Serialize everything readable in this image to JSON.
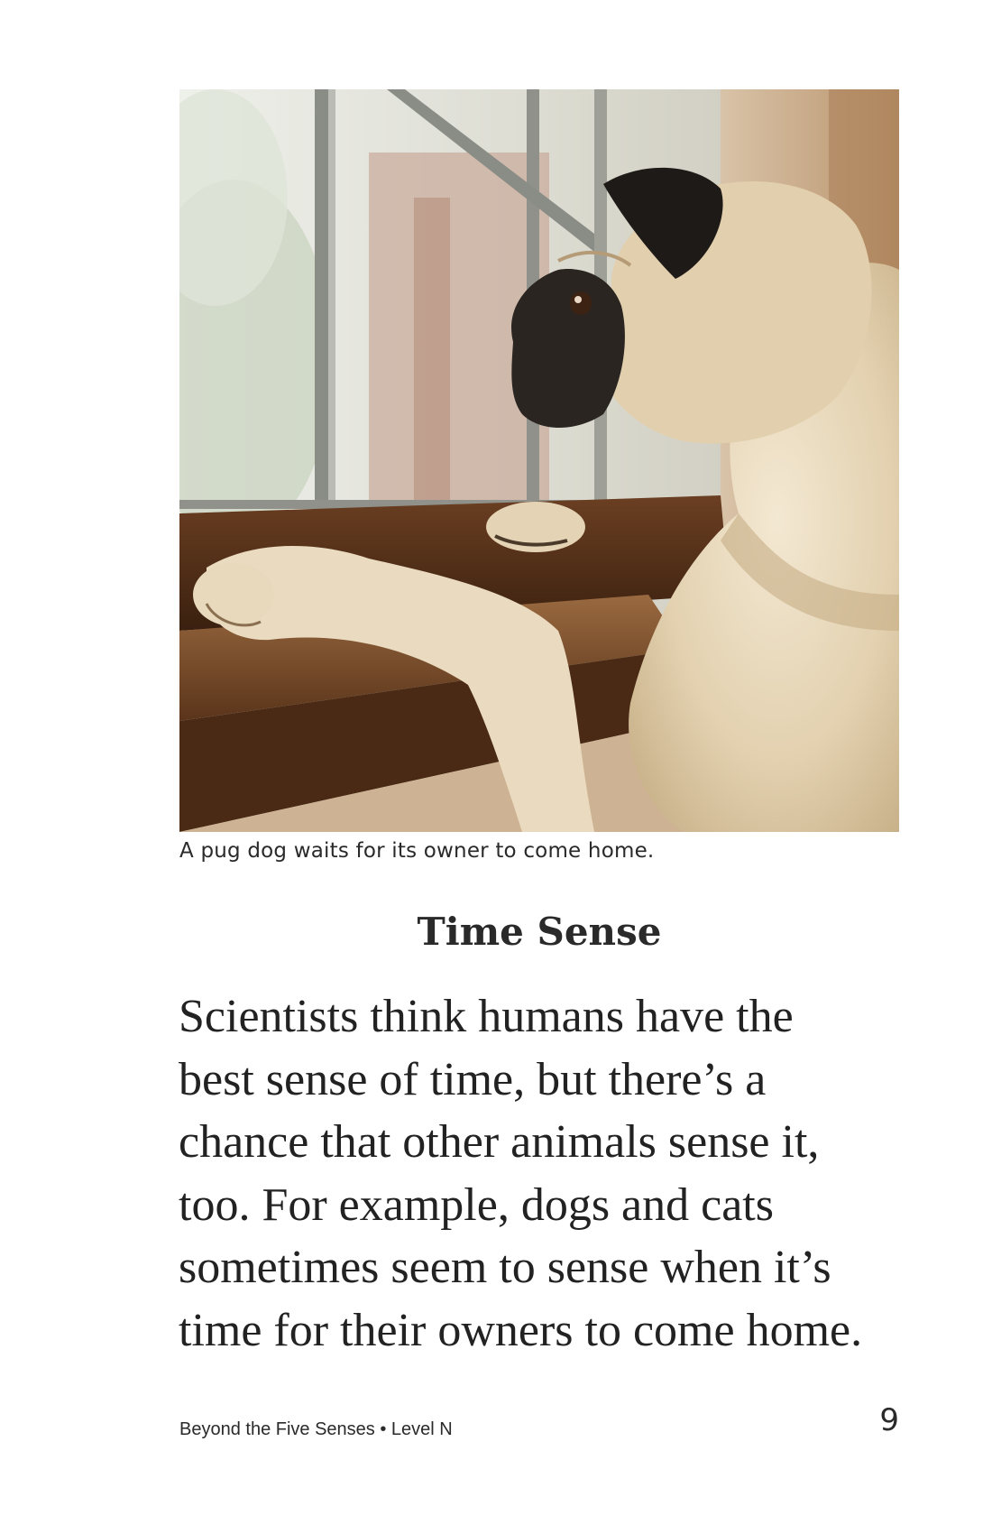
{
  "photo": {
    "caption": "A pug dog waits for its owner to come home."
  },
  "section": {
    "heading": "Time Sense",
    "body_lines": [
      "Scientists think humans have the",
      "best sense of time, but there’s a",
      "chance that other animals sense it,",
      "too. For example, dogs and cats",
      "sometimes seem to sense when it’s",
      "time for their owners to come home."
    ]
  },
  "footer": {
    "book_info": "Beyond the Five Senses • Level N",
    "page_number": "9"
  }
}
